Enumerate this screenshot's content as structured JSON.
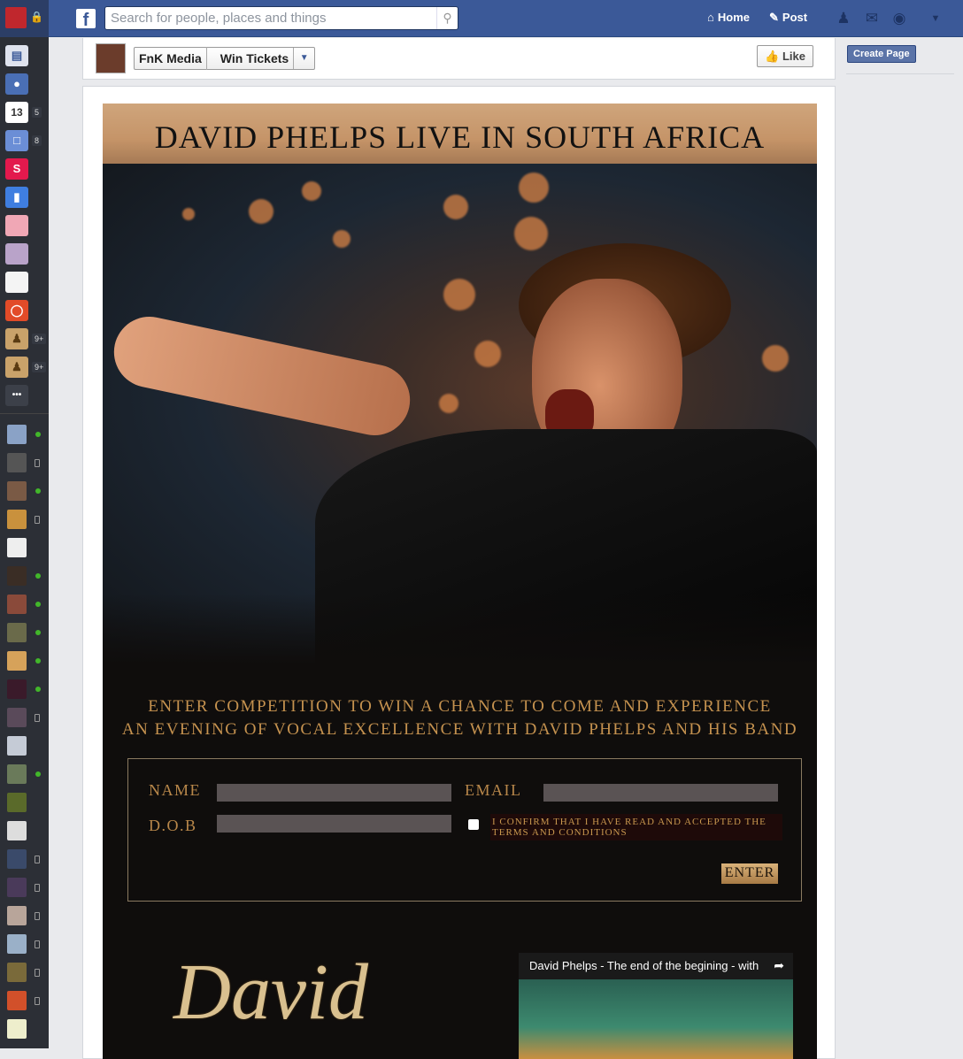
{
  "topbar": {
    "logo": "f",
    "search_placeholder": "Search for people, places and things",
    "home_label": "Home",
    "post_label": "Post"
  },
  "rail": {
    "badges": [
      "5",
      "8",
      "9+",
      "9+"
    ],
    "calendar_day": "13",
    "more": "•••"
  },
  "page_header": {
    "crumb_page": "FnK Media",
    "crumb_tab": "Win Tickets",
    "like_label": "Like"
  },
  "right_column": {
    "create_page_label": "Create Page"
  },
  "promo": {
    "title": "DAVID PHELPS LIVE IN SOUTH AFRICA",
    "line1": "ENTER  COMPETITION  TO WIN A CHANCE TO COME AND EXPERIENCE",
    "line2": "AN EVENING OF VOCAL EXCELLENCE WITH DAVID PHELPS AND HIS BAND",
    "form": {
      "name_label": "NAME",
      "email_label": "EMAIL",
      "dob_label": "D.O.B",
      "terms_text": "I CONFIRM THAT I HAVE READ AND ACCEPTED THE TERMS AND CONDITIONS",
      "enter_label": "ENTER"
    },
    "logo_text": "David",
    "video_title": "David Phelps - The end of the begining - with"
  },
  "colors": {
    "facebook_blue": "#3b5998",
    "promo_gold": "#c5924f",
    "promo_bg": "#0f0d0c"
  }
}
